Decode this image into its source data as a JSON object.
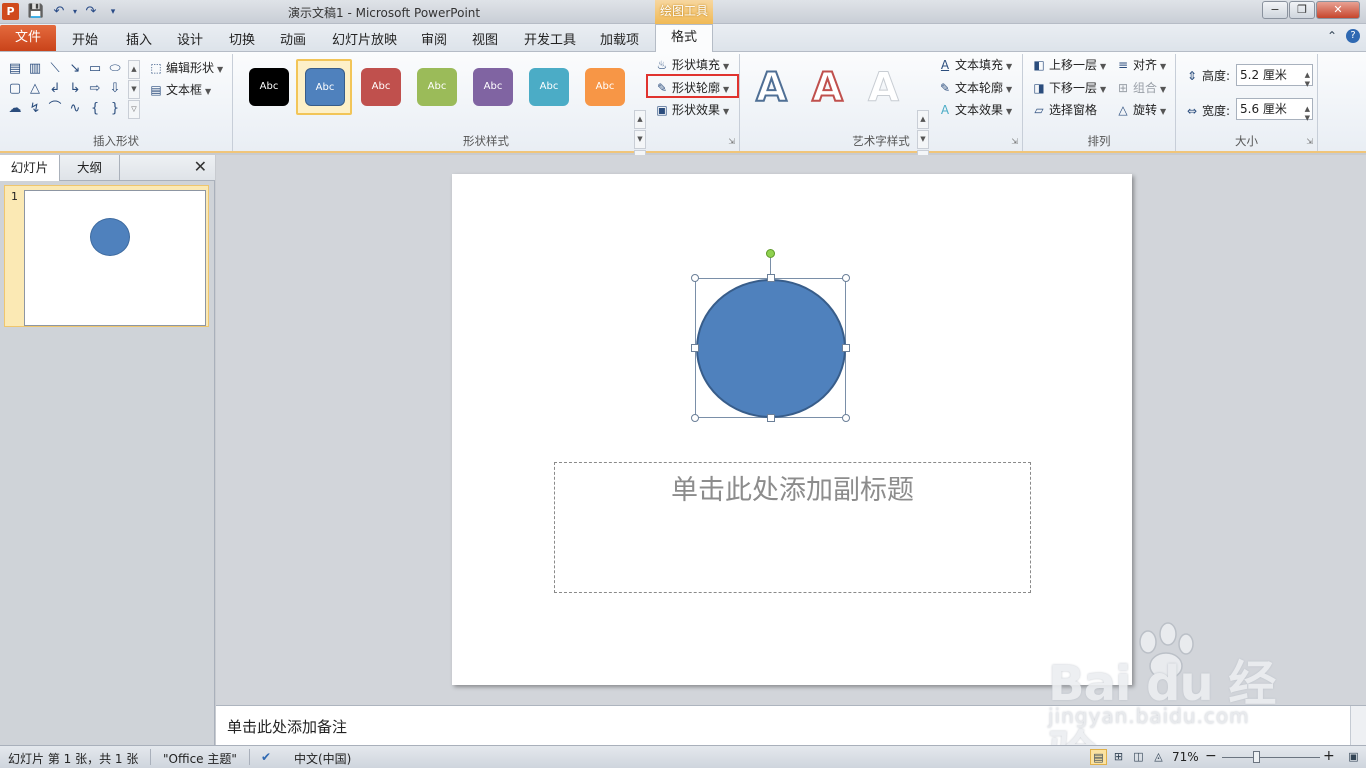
{
  "titlebar": {
    "app_logo": "P",
    "window_title": "演示文稿1  -  Microsoft PowerPoint",
    "contextual_tab_group": "绘图工具",
    "qat": [
      "save-icon",
      "undo-icon",
      "redo-icon",
      "customize-qat-icon"
    ],
    "window_buttons": {
      "minimize": "−",
      "restore": "❐",
      "close": "✕"
    }
  },
  "tabs": {
    "file": "文件",
    "items": [
      "开始",
      "插入",
      "设计",
      "切换",
      "动画",
      "幻灯片放映",
      "审阅",
      "视图",
      "开发工具",
      "加载项"
    ],
    "format": "格式",
    "help_icon": "?"
  },
  "ribbon": {
    "insert_shapes": {
      "label": "插入形状",
      "edit_shape": "编辑形状",
      "text_box": "文本框"
    },
    "shape_styles": {
      "label": "形状样式",
      "swatch_text": "Abc",
      "swatch_colors": [
        "#000000",
        "#4f81bd",
        "#c0504d",
        "#9bbb59",
        "#8064a2",
        "#4bacc6",
        "#f79646"
      ],
      "shape_fill": "形状填充",
      "shape_outline": "形状轮廓",
      "shape_effects": "形状效果"
    },
    "wordart_styles": {
      "label": "艺术字样式",
      "letter": "A",
      "text_fill": "文本填充",
      "text_outline": "文本轮廓",
      "text_effects": "文本效果"
    },
    "arrange": {
      "label": "排列",
      "bring_forward": "上移一层",
      "send_backward": "下移一层",
      "selection_pane": "选择窗格",
      "align": "对齐",
      "group": "组合",
      "rotate": "旋转"
    },
    "size": {
      "label": "大小",
      "height_label": "高度:",
      "height_value": "5.2 厘米",
      "width_label": "宽度:",
      "width_value": "5.6 厘米"
    }
  },
  "left_pane": {
    "tab_slides": "幻灯片",
    "tab_outline": "大纲",
    "close": "✕",
    "slide_number": "1"
  },
  "slide": {
    "subtitle_placeholder": "单击此处添加副标题",
    "shape_fill_color": "#4f81bd"
  },
  "notes": {
    "placeholder": "单击此处添加备注"
  },
  "watermark": {
    "logo": "Bai du 经验",
    "sub": "jingyan.baidu.com"
  },
  "statusbar": {
    "slide_info": "幻灯片 第 1 张，共 1 张",
    "theme": "\"Office 主题\"",
    "language": "中文(中国)",
    "zoom": "71%",
    "zoom_out": "−",
    "zoom_in": "+"
  }
}
